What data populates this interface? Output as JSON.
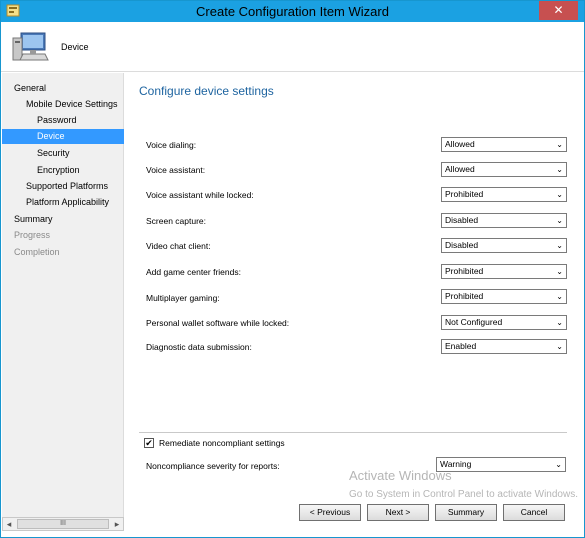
{
  "window": {
    "title": "Create Configuration Item Wizard",
    "close_label": "✕"
  },
  "header": {
    "title": "Device"
  },
  "nav": {
    "items": [
      {
        "label": "General",
        "state": "normal"
      },
      {
        "label": "Mobile Device Settings",
        "state": "normal"
      },
      {
        "label": "Password",
        "state": "normal"
      },
      {
        "label": "Device",
        "state": "selected"
      },
      {
        "label": "Security",
        "state": "normal"
      },
      {
        "label": "Encryption",
        "state": "normal"
      },
      {
        "label": "Supported Platforms",
        "state": "normal"
      },
      {
        "label": "Platform Applicability",
        "state": "normal"
      },
      {
        "label": "Summary",
        "state": "normal"
      },
      {
        "label": "Progress",
        "state": "disabled"
      },
      {
        "label": "Completion",
        "state": "disabled"
      }
    ]
  },
  "scrollbar": {
    "left": "◂",
    "thumb": "III",
    "right": "▸"
  },
  "main": {
    "title": "Configure device settings",
    "settings": [
      {
        "label": "Voice dialing:",
        "value": "Allowed"
      },
      {
        "label": "Voice assistant:",
        "value": "Allowed"
      },
      {
        "label": "Voice assistant while locked:",
        "value": "Prohibited"
      },
      {
        "label": "Screen capture:",
        "value": "Disabled"
      },
      {
        "label": "Video chat client:",
        "value": "Disabled"
      },
      {
        "label": "Add game center friends:",
        "value": "Prohibited"
      },
      {
        "label": "Multiplayer gaming:",
        "value": "Prohibited"
      },
      {
        "label": "Personal wallet software while locked:",
        "value": "Not Configured"
      },
      {
        "label": "Diagnostic data submission:",
        "value": "Enabled"
      }
    ],
    "remediate": {
      "label": "Remediate noncompliant settings",
      "checked": true,
      "mark": "✔"
    },
    "severity": {
      "label": "Noncompliance severity for reports:",
      "value": "Warning"
    },
    "dropdown_glyph": "⌄"
  },
  "buttons": {
    "previous": "< Previous",
    "next": "Next >",
    "summary": "Summary",
    "cancel": "Cancel"
  },
  "watermark": {
    "line1": "Activate Windows",
    "line2": "Go to System in Control Panel to activate Windows."
  }
}
